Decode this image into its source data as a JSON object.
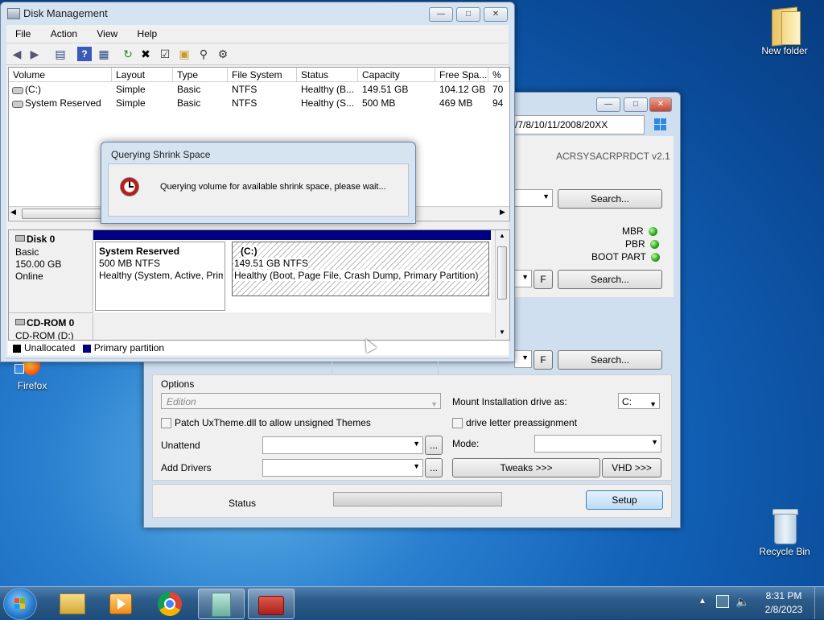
{
  "desktop": {
    "icons": [
      {
        "label": "New folder"
      },
      {
        "label": "Firefox"
      },
      {
        "label": "Recycle Bin"
      }
    ]
  },
  "setup_window": {
    "path_field": "/7/8/10/11/2008/20XX",
    "brand_text": "ACRSYSACRPRDCT v2.1",
    "search_label": "Search...",
    "mbr_label": "MBR",
    "pbr_label": "PBR",
    "boot_part_label": "BOOT PART",
    "f_label": "F",
    "options_label": "Options",
    "edition_placeholder": "Edition",
    "mount_label": "Mount Installation drive as:",
    "mount_value": "C:",
    "patch_label": "Patch UxTheme.dll to allow unsigned Themes",
    "drive_letter_label": "drive letter preassignment",
    "unattend_label": "Unattend",
    "mode_label": "Mode:",
    "add_drivers_label": "Add Drivers",
    "browse_label": "...",
    "tweaks_label": "Tweaks >>>",
    "vhd_label": "VHD >>>",
    "status_label": "Status",
    "setup_label": "Setup"
  },
  "disk_mgmt": {
    "title": "Disk Management",
    "menu": [
      "File",
      "Action",
      "View",
      "Help"
    ],
    "columns": [
      "Volume",
      "Layout",
      "Type",
      "File System",
      "Status",
      "Capacity",
      "Free Spa...",
      "% F"
    ],
    "rows": [
      [
        "(C:)",
        "Simple",
        "Basic",
        "NTFS",
        "Healthy (B...",
        "149.51 GB",
        "104.12 GB",
        "70"
      ],
      [
        "System Reserved",
        "Simple",
        "Basic",
        "NTFS",
        "Healthy (S...",
        "500 MB",
        "469 MB",
        "94"
      ]
    ],
    "disk0": {
      "name": "Disk 0",
      "type": "Basic",
      "size": "150.00 GB",
      "state": "Online",
      "part1_title": "System Reserved",
      "part1_size": "500 MB NTFS",
      "part1_status": "Healthy (System, Active, Prim",
      "part2_title": "(C:)",
      "part2_size": "149.51 GB NTFS",
      "part2_status": "Healthy (Boot, Page File, Crash Dump, Primary Partition)"
    },
    "cdrom": {
      "name": "CD-ROM 0",
      "drive": "CD-ROM (D:)"
    },
    "legend": {
      "unallocated": "Unallocated",
      "primary": "Primary partition"
    }
  },
  "dialog": {
    "title": "Querying Shrink Space",
    "message": "Querying volume for available shrink space, please wait..."
  },
  "taskbar": {
    "time": "8:31 PM",
    "date": "2/8/2023"
  },
  "colors": {
    "primary_partition": "#000080",
    "unallocated": "#000000"
  }
}
